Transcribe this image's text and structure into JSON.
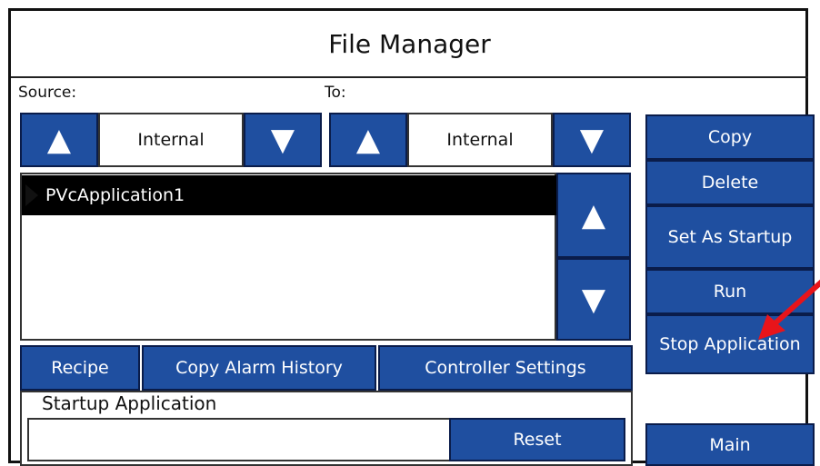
{
  "header": {
    "title": "File Manager"
  },
  "source": {
    "label": "Source:",
    "value": "Internal",
    "up_icon": "triangle-up",
    "down_icon": "triangle-down"
  },
  "destination": {
    "label": "To:",
    "value": "Internal",
    "up_icon": "triangle-up",
    "down_icon": "triangle-down"
  },
  "app_list": {
    "items": [
      {
        "name": "PVcApplication1",
        "selected": true
      }
    ],
    "scroll_up_icon": "triangle-up",
    "scroll_down_icon": "triangle-down"
  },
  "actions": {
    "copy": "Copy",
    "delete": "Delete",
    "set_startup": "Set As Startup",
    "run": "Run",
    "stop": "Stop Application",
    "main": "Main"
  },
  "tabs": {
    "recipe": "Recipe",
    "copy_alarm": "Copy Alarm History",
    "controller": "Controller Settings"
  },
  "startup": {
    "label": "Startup Application",
    "value": "",
    "reset": "Reset"
  },
  "glyphs": {
    "up": "▲",
    "down": "▼"
  },
  "colors": {
    "button_blue": "#1f4fa0",
    "selected_row": "#000000",
    "annotation_red": "#e8141a"
  }
}
